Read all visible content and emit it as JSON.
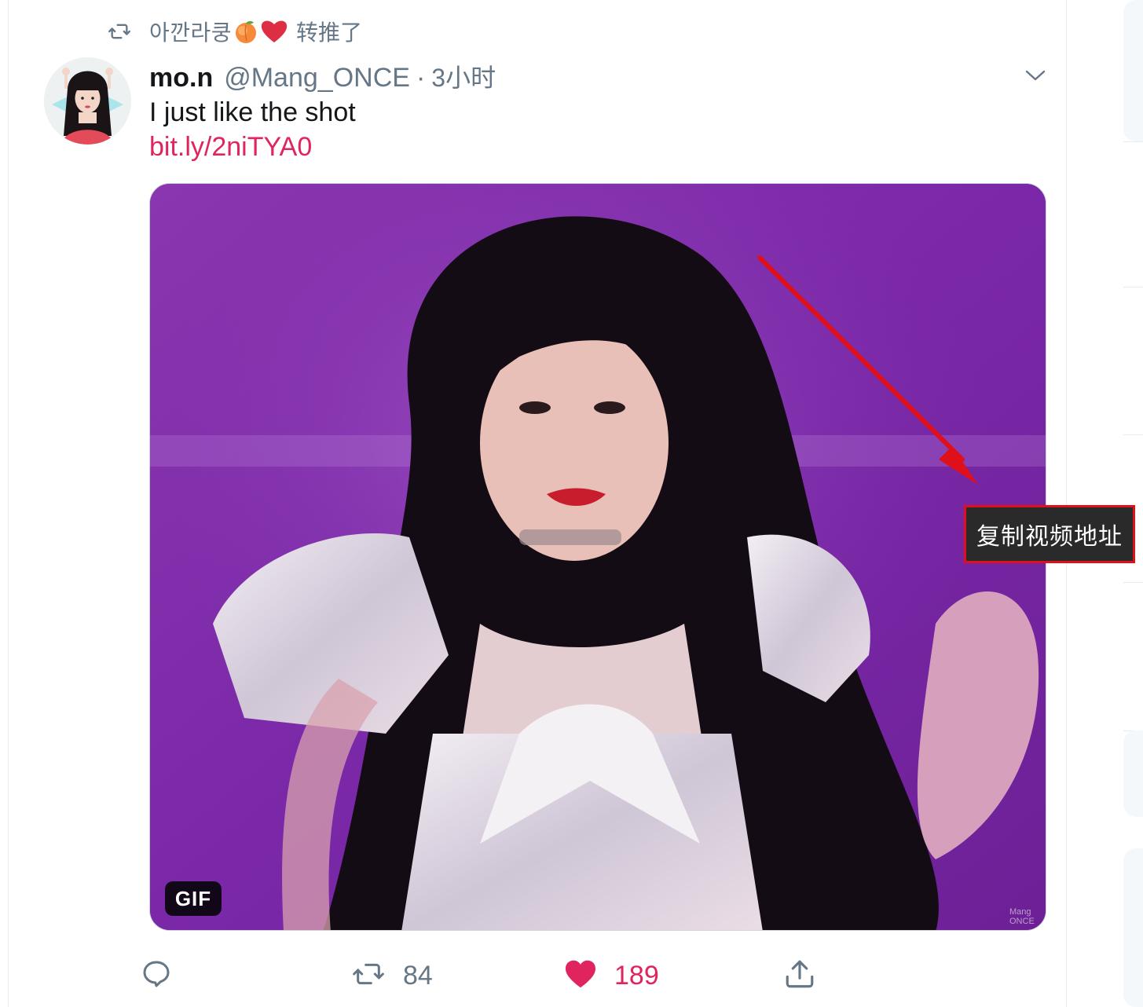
{
  "social_context": {
    "retweeter_name": "아깐라쿵",
    "suffix": "转推了",
    "emojis": [
      "peach",
      "red-heart"
    ]
  },
  "tweet": {
    "display_name": "mo.n",
    "handle": "@Mang_ONCE",
    "separator": "·",
    "time": "3小时",
    "text": "I just like the shot",
    "link": "bit.ly/2niTYA0",
    "media": {
      "badge": "GIF",
      "watermark_line1": "Mang",
      "watermark_line2": "ONCE"
    },
    "context_menu_item": "复制视频地址",
    "actions": {
      "reply_count": "",
      "retweet_count": "84",
      "like_count": "189"
    }
  },
  "colors": {
    "link": "#e0245e",
    "secondary_text": "#657786",
    "like_active": "#e0245e",
    "annotation_red": "#e0101a",
    "media_bg": "#7b2da6"
  },
  "icons": [
    "retweet-icon",
    "caret-down-icon",
    "reply-icon",
    "retweet-icon",
    "heart-filled-icon",
    "share-icon"
  ]
}
